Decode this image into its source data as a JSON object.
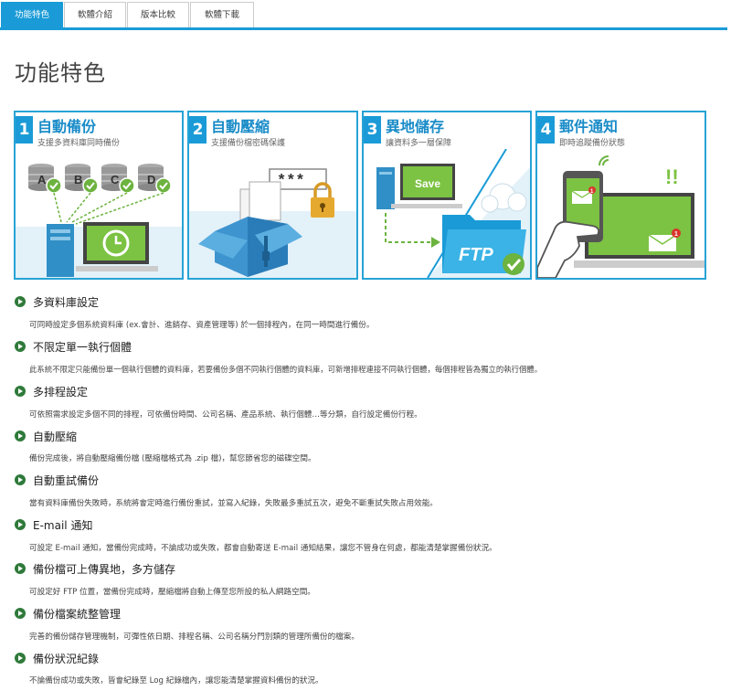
{
  "tabs": [
    {
      "label": "功能特色",
      "active": true
    },
    {
      "label": "軟體介紹",
      "active": false
    },
    {
      "label": "版本比較",
      "active": false
    },
    {
      "label": "軟體下載",
      "active": false
    }
  ],
  "page_title": "功能特色",
  "panels": [
    {
      "num": "1",
      "title": "自動備份",
      "subtitle": "支援多資料庫同時備份",
      "db_letters": [
        "A",
        "B",
        "C",
        "D"
      ]
    },
    {
      "num": "2",
      "title": "自動壓縮",
      "subtitle": "支援備份檔密碼保護",
      "password_text": "***"
    },
    {
      "num": "3",
      "title": "異地儲存",
      "subtitle": "讓資料多一層保障",
      "save_label": "Save",
      "ftp_label": "FTP"
    },
    {
      "num": "4",
      "title": "郵件通知",
      "subtitle": "即時追蹤備份狀態",
      "badge": "1",
      "alert": "!!"
    }
  ],
  "features": [
    {
      "title": "多資料庫設定",
      "desc": "可同時設定多個系統資料庫 (ex.會計、進銷存、資產管理等) 於一個排程內，在同一時間進行備份。"
    },
    {
      "title": "不限定單一執行個體",
      "desc": "此系統不限定只能備份單一個執行個體的資料庫，若要備份多個不同執行個體的資料庫，可新增排程連接不同執行個體，每個排程皆為獨立的執行個體。"
    },
    {
      "title": "多排程設定",
      "desc": "可依照需求設定多個不同的排程，可依備份時間、公司名稱、產品系統、執行個體…等分類，自行設定備份行程。"
    },
    {
      "title": "自動壓縮",
      "desc": "備份完成後，將自動壓縮備份檔 (壓縮檔格式為 .zip 檔)，幫您節省您的磁碟空間。"
    },
    {
      "title": "自動重試備份",
      "desc": "當有資料庫備份失敗時，系統將會定時進行備份重試，並寫入紀錄，失敗最多重試五次，避免不斷重試失敗占用效能。"
    },
    {
      "title": "E-mail 通知",
      "desc": "可設定 E-mail 通知，當備份完成時，不論成功或失敗，都會自動寄送 E-mail 通知結果，讓您不管身在何處，都能清楚掌握備份狀況。"
    },
    {
      "title": "備份檔可上傳異地，多方儲存",
      "desc": "可設定好 FTP 位置，當備份完成時，壓縮檔將自動上傳至您所設的私人網路空間。"
    },
    {
      "title": "備份檔案統整管理",
      "desc": "完善的備份儲存管理機制，可彈性依日期、排程名稱、公司名稱分門別類的管理所備份的檔案。"
    },
    {
      "title": "備份狀況紀錄",
      "desc": "不論備份成功或失敗，皆會紀錄至 Log 紀錄檔內，讓您能清楚掌握資料備份的狀況。"
    }
  ]
}
